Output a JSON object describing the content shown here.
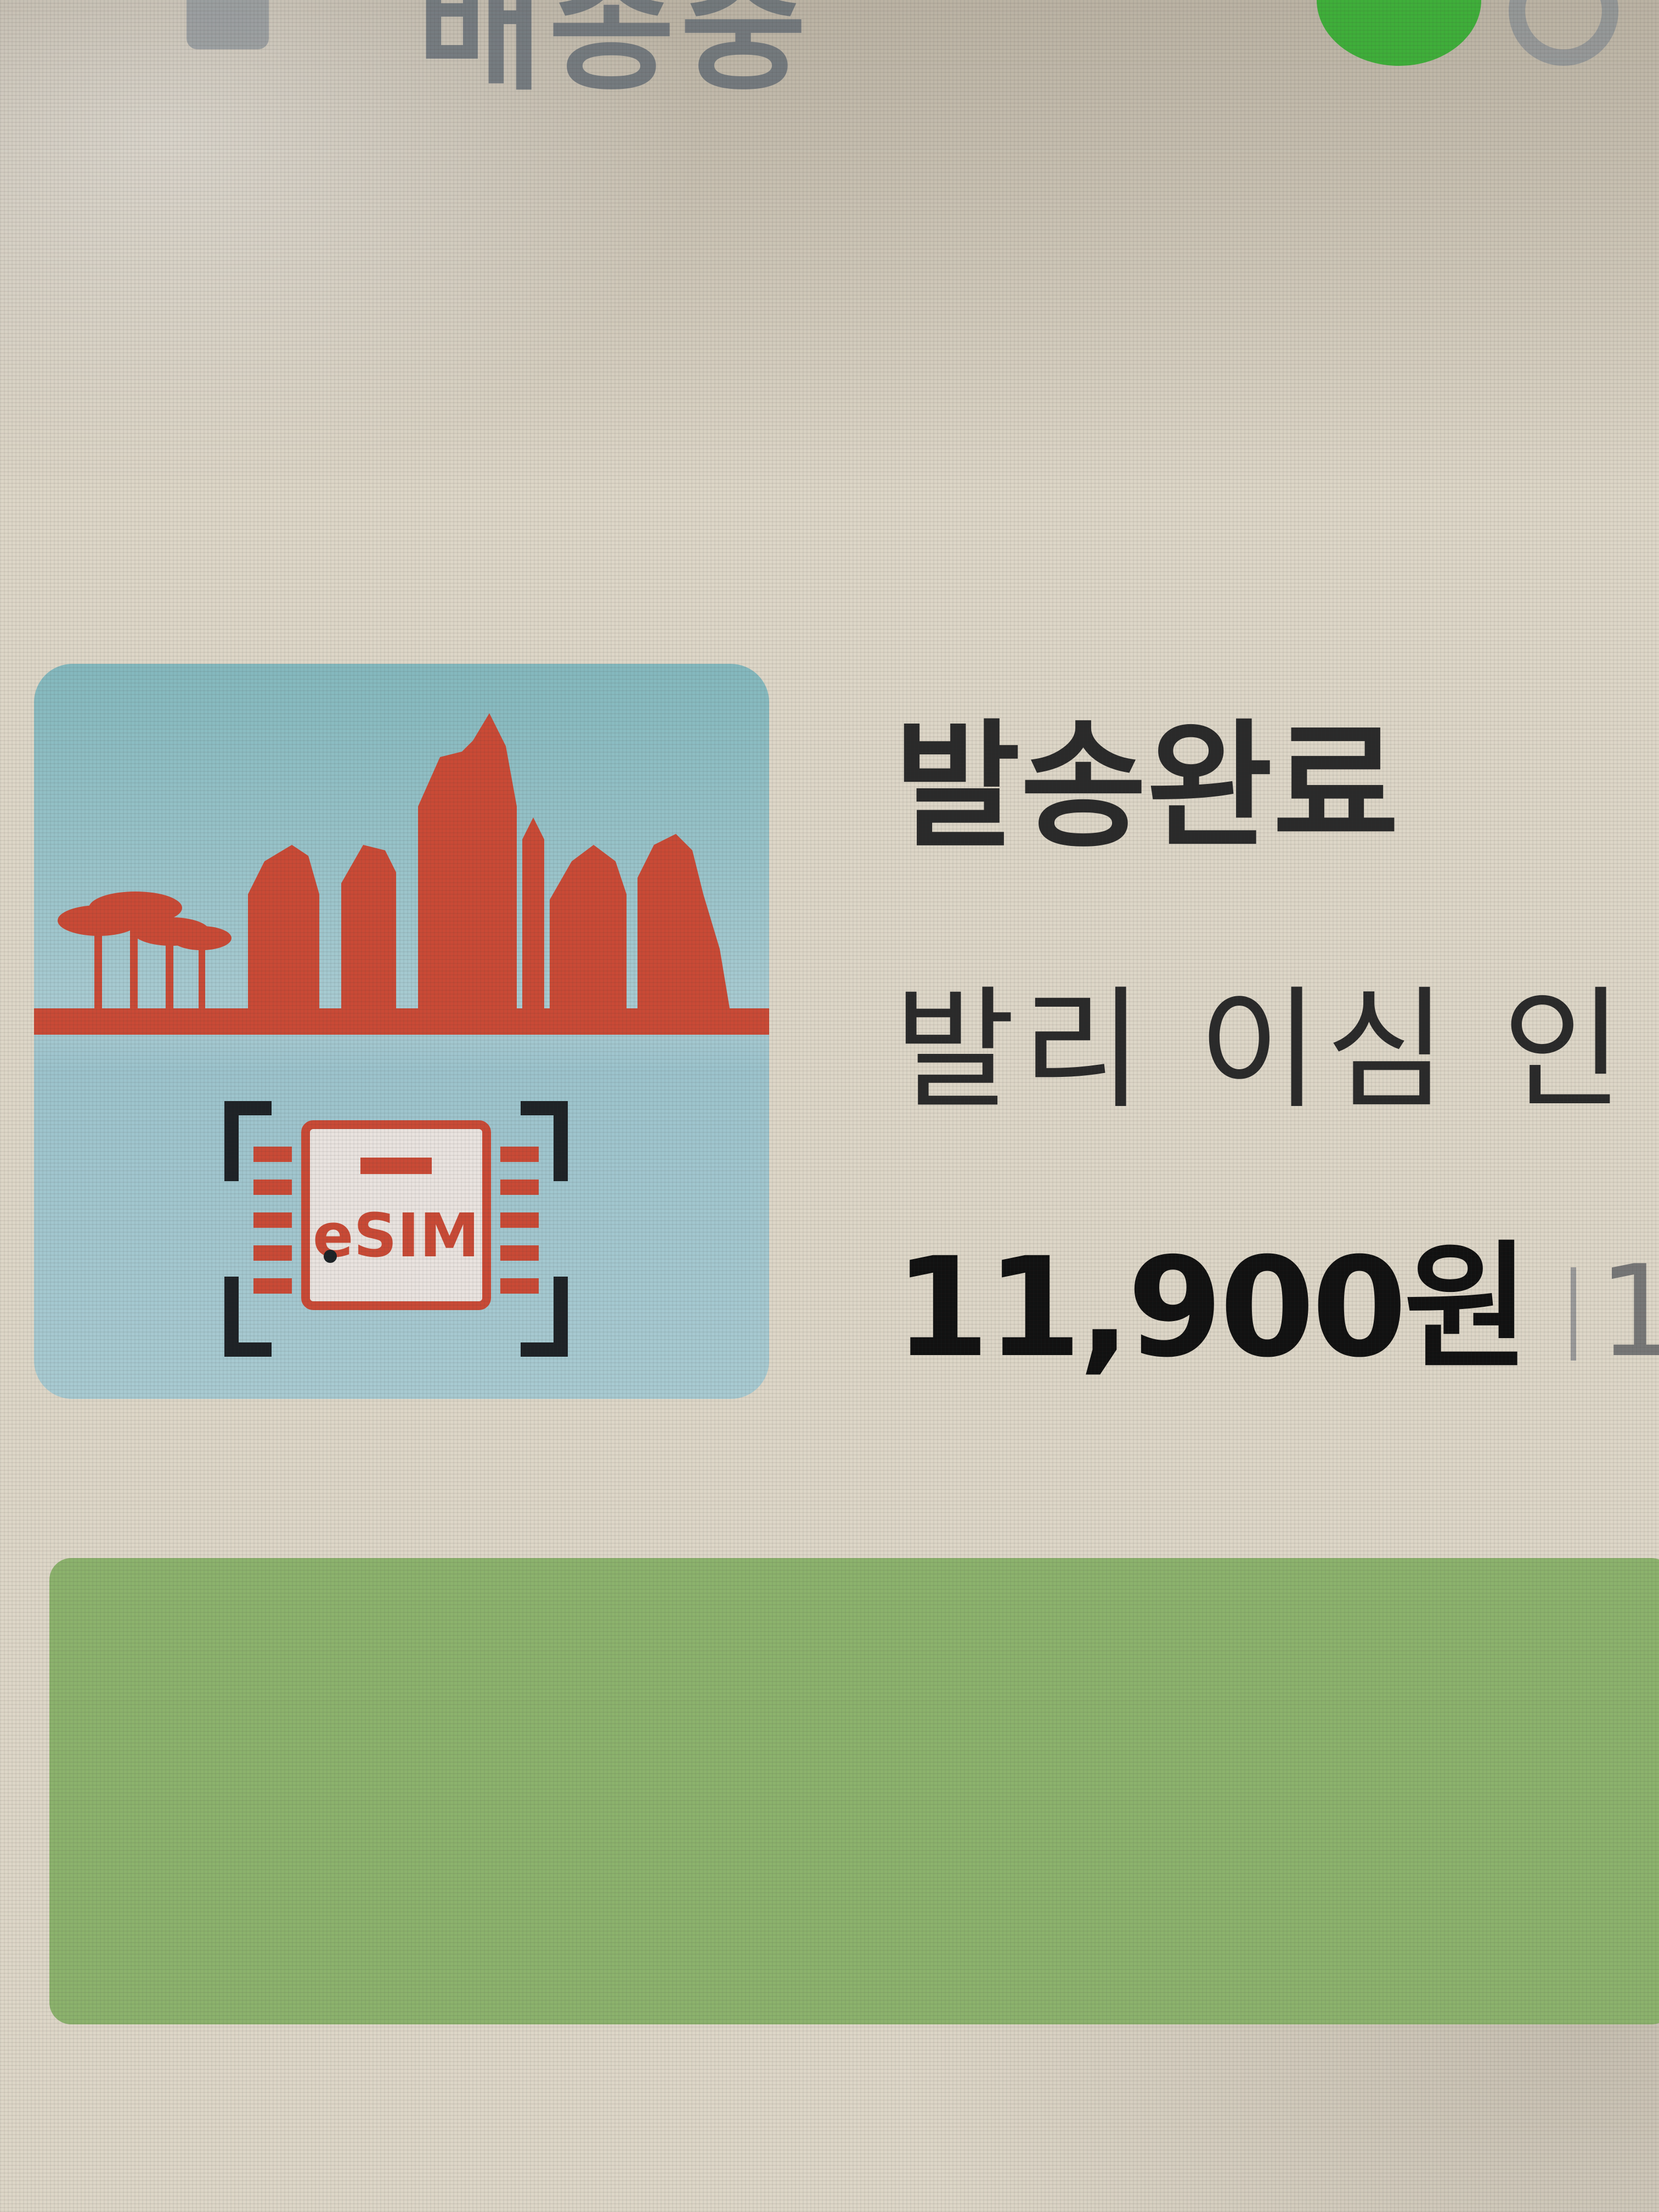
{
  "header": {
    "title_partial": "배송중",
    "badge_icon": "green-status-icon"
  },
  "order_item": {
    "thumbnail_icon": "bali-esim-icon",
    "thumbnail_label": "eSIM",
    "status": "발송완료",
    "product_name": "발리 이심 인",
    "price": "11,900원",
    "quantity_partial": "1"
  },
  "action_bar": {
    "label": "",
    "color": "#8cb26d"
  },
  "colors": {
    "skyline": "#c94a36",
    "thumb_bg": "#a9cbd2",
    "badge": "#3fae3a"
  }
}
